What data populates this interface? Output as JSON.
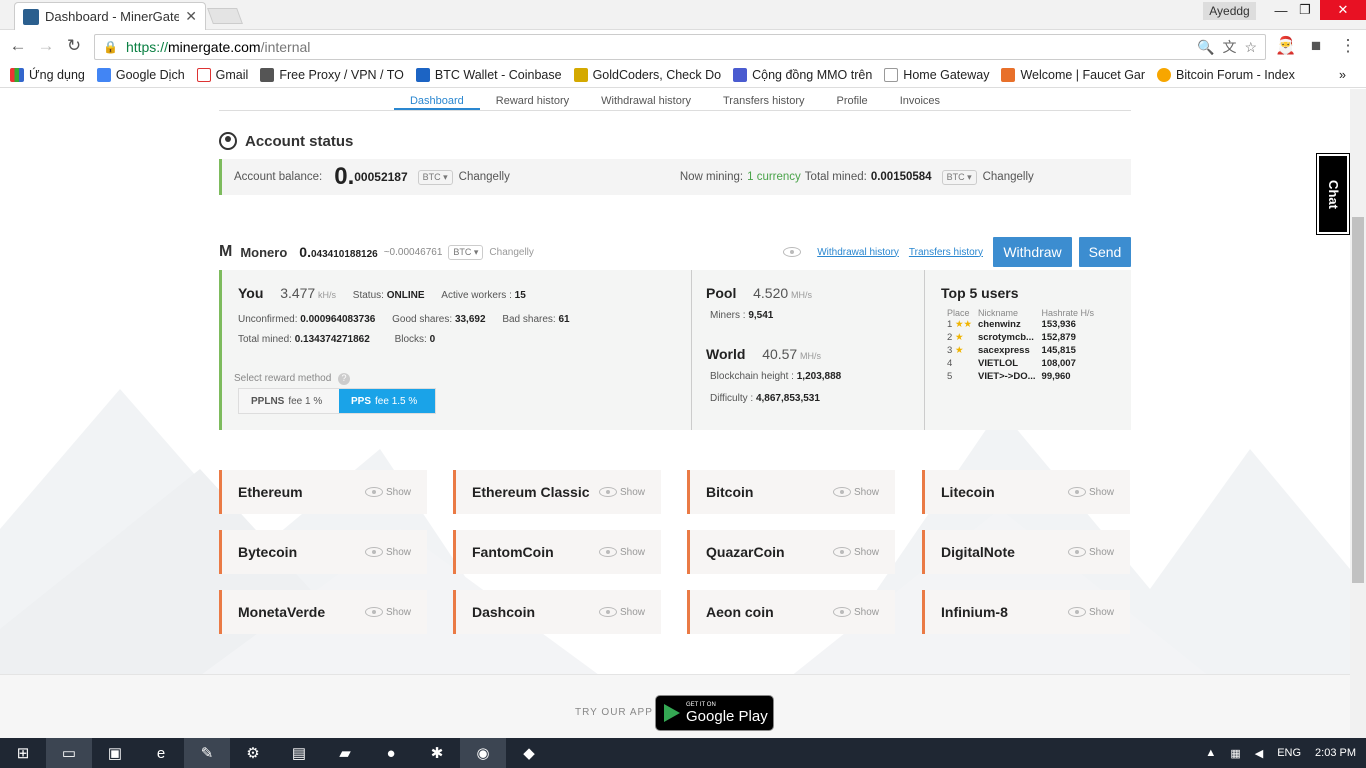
{
  "browser": {
    "tab_title": "Dashboard - MinerGate.c",
    "user": "Ayeddg",
    "url_scheme": "https://",
    "url_host": "minergate.com",
    "url_path": "/internal",
    "bookmarks": [
      "Ứng dụng",
      "Google Dịch",
      "Gmail",
      "Free Proxy / VPN / TO",
      "BTC Wallet - Coinbase",
      "GoldCoders, Check Do",
      "Cộng đồng MMO trên",
      "Home Gateway",
      "Welcome | Faucet Gar",
      "Bitcoin Forum - Index"
    ],
    "bookmark_more": "»"
  },
  "subnav": [
    "Dashboard",
    "Reward history",
    "Withdrawal history",
    "Transfers history",
    "Profile",
    "Invoices"
  ],
  "account": {
    "title": "Account status",
    "balance_label": "Account balance:",
    "balance_int": "0.",
    "balance_dec": "00052187",
    "currency": "BTC",
    "changelly": "Changelly",
    "now_mining_label": "Now mining:",
    "now_mining_value": "1 currency",
    "total_mined_label": "Total mined:",
    "total_mined_value": "0.00150584"
  },
  "monero": {
    "name": "Monero",
    "balance_int": "0.",
    "balance_dec": "043410188126",
    "btc_equiv": "~0.00046761",
    "currency": "BTC",
    "changelly": "Changelly",
    "withdrawal_history": "Withdrawal history",
    "transfers_history": "Transfers history",
    "withdraw": "Withdraw",
    "send": "Send"
  },
  "you": {
    "label": "You",
    "hashrate": "3.477",
    "unit": "kH/s",
    "status_label": "Status:",
    "status": "ONLINE",
    "workers_label": "Active workers :",
    "workers": "15",
    "unconfirmed_label": "Unconfirmed:",
    "unconfirmed": "0.000964083736",
    "good_label": "Good shares:",
    "good": "33,692",
    "bad_label": "Bad shares:",
    "bad": "61",
    "total_label": "Total mined:",
    "total": "0.134374271862",
    "blocks_label": "Blocks:",
    "blocks": "0",
    "reward_method": "Select reward method",
    "pplns": "PPLNS",
    "pplns_fee": "fee  1 %",
    "pps": "PPS",
    "pps_fee": "fee  1.5 %"
  },
  "pool": {
    "label": "Pool",
    "hashrate": "4.520",
    "unit": "MH/s",
    "miners_label": "Miners :",
    "miners": "9,541",
    "world_label": "World",
    "world_hashrate": "40.57",
    "world_unit": "MH/s",
    "height_label": "Blockchain height :",
    "height": "1,203,888",
    "diff_label": "Difficulty :",
    "diff": "4,867,853,531"
  },
  "top5": {
    "title": "Top 5 users",
    "headers": [
      "Place",
      "Nickname",
      "Hashrate H/s"
    ],
    "rows": [
      [
        "1",
        "chenwinz",
        "153,936"
      ],
      [
        "2",
        "scrotymcb...",
        "152,879"
      ],
      [
        "3",
        "sacexpress",
        "145,815"
      ],
      [
        "4",
        "VIETLOL",
        "108,007"
      ],
      [
        "5",
        "VIET>->DO...",
        "99,960"
      ]
    ]
  },
  "coins": [
    "Ethereum",
    "Ethereum Classic",
    "Bitcoin",
    "Litecoin",
    "Bytecoin",
    "FantomCoin",
    "QuazarCoin",
    "DigitalNote",
    "MonetaVerde",
    "Dashcoin",
    "Aeon coin",
    "Infinium-8"
  ],
  "show_label": "Show",
  "footer": {
    "try": "TRY OUR APP",
    "get_it": "GET IT ON",
    "google_play": "Google Play"
  },
  "chat": "Chat",
  "tray": {
    "lang": "ENG",
    "time": "2:03 PM"
  }
}
